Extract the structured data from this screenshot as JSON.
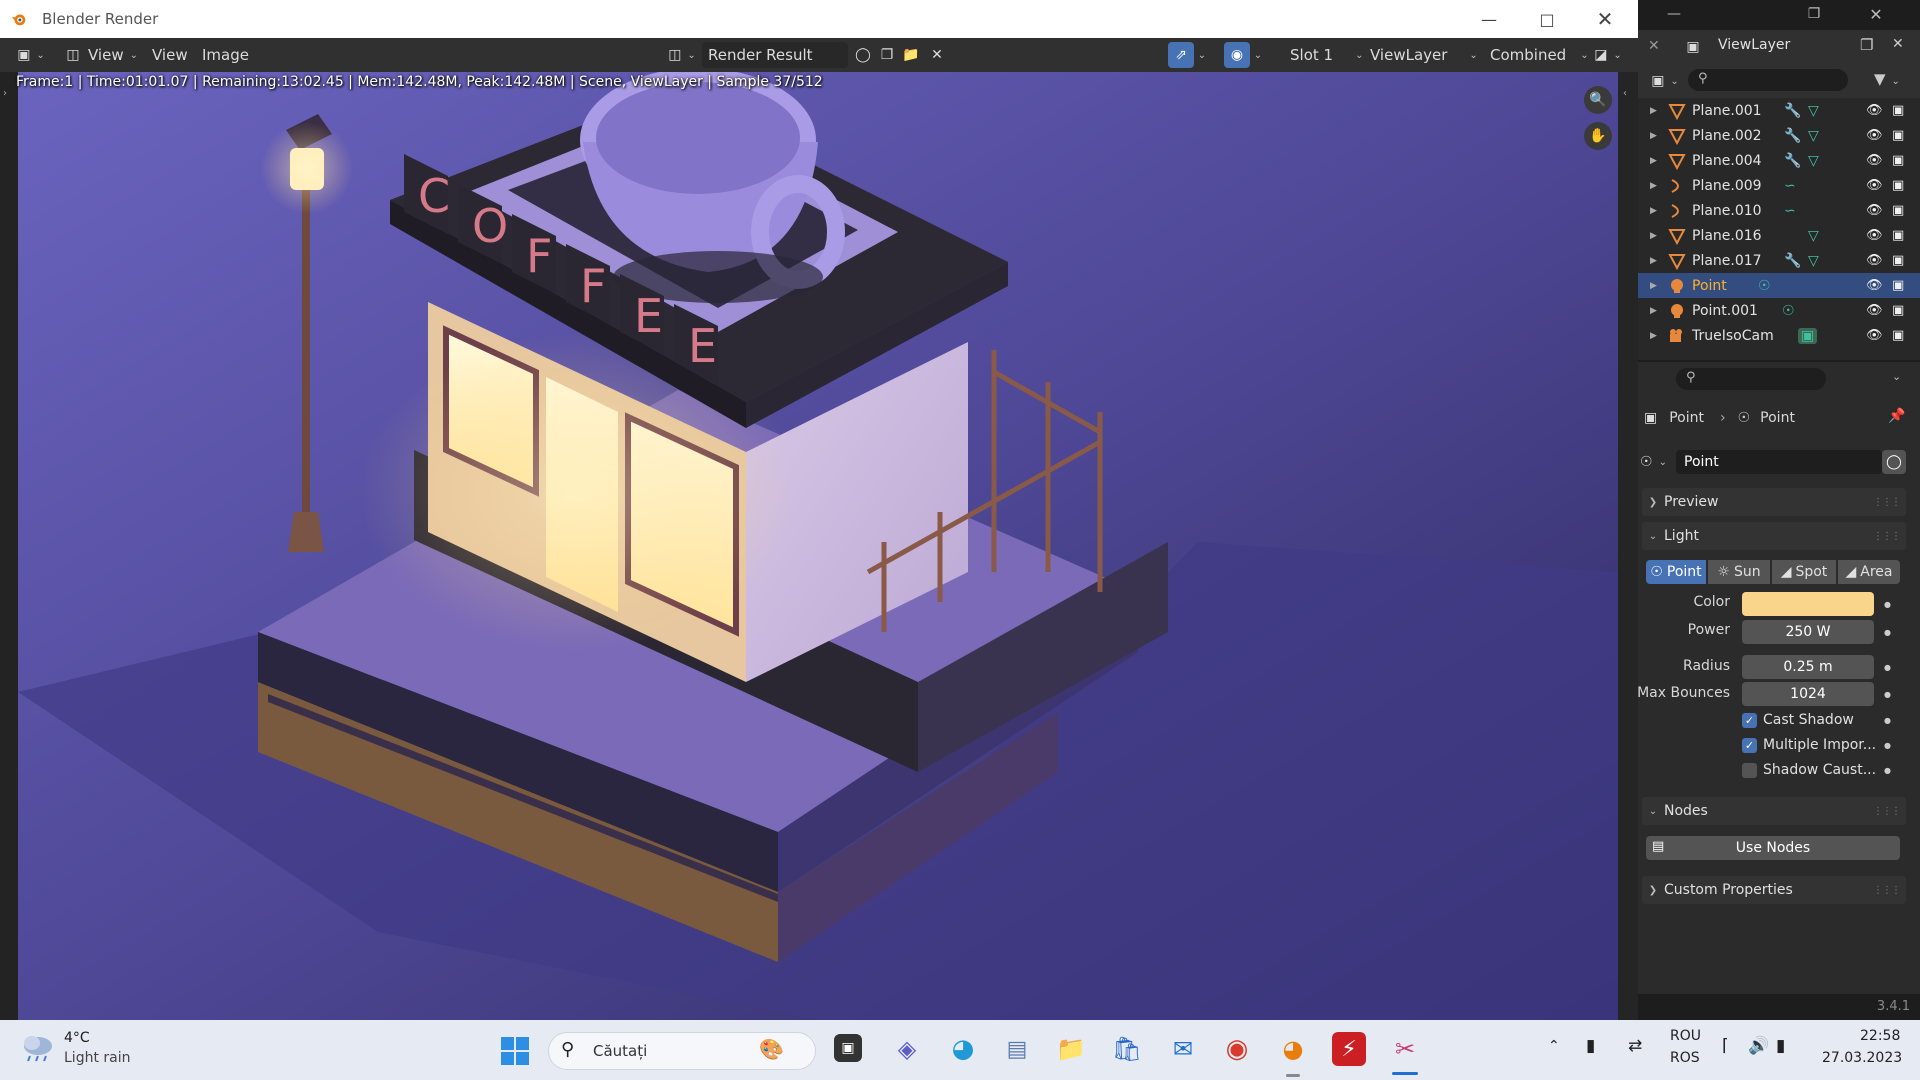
{
  "window": {
    "title": "Blender Render",
    "min_icon": "minimize-icon",
    "max_icon": "maximize-icon",
    "close_icon": "close-icon"
  },
  "render_header": {
    "view_menu": "View",
    "menu_view": "View",
    "menu_image": "Image",
    "image_name": "Render Result",
    "slot": "Slot 1",
    "view_layer": "ViewLayer",
    "pass": "Combined"
  },
  "stats": "Frame:1 | Time:01:01.07 | Remaining:13:02.45 | Mem:142.48M, Peak:142.48M | Scene, ViewLayer | Sample 37/512",
  "scene_text": {
    "sign": [
      "C",
      "O",
      "F",
      "F",
      "E",
      "E"
    ]
  },
  "outliner": {
    "view_layer": "ViewLayer",
    "items": [
      {
        "label": "Plane.001",
        "icon": "mesh-icon",
        "mods": [
          "wrench-icon",
          "mesh-data-icon"
        ],
        "selected": false
      },
      {
        "label": "Plane.002",
        "icon": "mesh-icon",
        "mods": [
          "wrench-icon",
          "mesh-data-icon"
        ],
        "selected": false
      },
      {
        "label": "Plane.004",
        "icon": "mesh-icon",
        "mods": [
          "wrench-icon",
          "mesh-data-icon"
        ],
        "selected": false
      },
      {
        "label": "Plane.009",
        "icon": "curve-icon",
        "mods": [
          "curve-data-icon"
        ],
        "selected": false
      },
      {
        "label": "Plane.010",
        "icon": "curve-icon",
        "mods": [
          "curve-data-icon"
        ],
        "selected": false
      },
      {
        "label": "Plane.016",
        "icon": "mesh-icon",
        "mods": [
          "mesh-data-icon"
        ],
        "selected": false
      },
      {
        "label": "Plane.017",
        "icon": "mesh-icon",
        "mods": [
          "wrench-icon",
          "mesh-data-icon"
        ],
        "selected": false
      },
      {
        "label": "Point",
        "icon": "light-icon",
        "mods": [
          "light-data-icon"
        ],
        "selected": true
      },
      {
        "label": "Point.001",
        "icon": "light-icon",
        "mods": [
          "light-data-icon"
        ],
        "selected": false
      },
      {
        "label": "TrueIsoCam",
        "icon": "camera-icon",
        "mods": [
          "camera-data-icon"
        ],
        "selected": false
      }
    ]
  },
  "properties": {
    "breadcrumb_object": "Point",
    "breadcrumb_data": "Point",
    "datablock": "Point",
    "panels": {
      "preview": "Preview",
      "light": "Light",
      "nodes": "Nodes",
      "custom": "Custom Properties"
    },
    "light_types": [
      "Point",
      "Sun",
      "Spot",
      "Area"
    ],
    "active_type": "Point",
    "color_label": "Color",
    "color_value": "#f8d58a",
    "power_label": "Power",
    "power_value": "250 W",
    "radius_label": "Radius",
    "radius_value": "0.25 m",
    "bounces_label": "Max Bounces",
    "bounces_value": "1024",
    "cast_shadow": "Cast Shadow",
    "multiple_importance": "Multiple Impor...",
    "shadow_caustics": "Shadow Caust...",
    "use_nodes": "Use Nodes",
    "version": "3.4.1"
  },
  "taskbar": {
    "weather_temp": "4°C",
    "weather_desc": "Light rain",
    "search": "Căutați",
    "lang_top": "ROU",
    "lang_bottom": "ROS",
    "time": "22:58",
    "date": "27.03.2023"
  },
  "colors": {
    "accent": "#4772b3",
    "selection": "#334d80",
    "light_color": "#f8d58a"
  }
}
